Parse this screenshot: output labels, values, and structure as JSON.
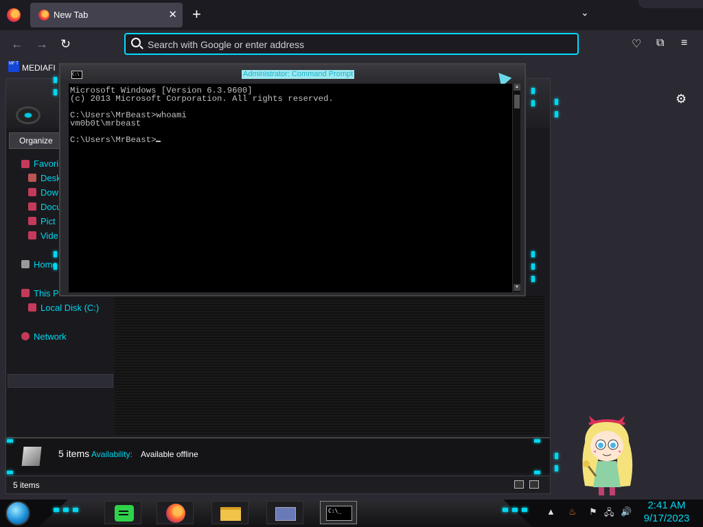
{
  "browser": {
    "tab_title": "New Tab",
    "tab_close": "✕",
    "new_tab": "+",
    "tab_list": "⌄",
    "url_placeholder": "Search with Google or enter address",
    "bookmark_label": "MEDIAFI",
    "bookmark_icon_text": "MF T",
    "nav": {
      "back": "←",
      "forward": "→",
      "reload": "↻"
    },
    "right_icons": {
      "pocket": "♡",
      "extensions": "⧉",
      "menu": "≡"
    },
    "settings_icon": "⚙"
  },
  "explorer": {
    "organize_label": "Organize",
    "tree": [
      {
        "label": "Favori",
        "indent": 0
      },
      {
        "label": "Desk",
        "indent": 1
      },
      {
        "label": "Dow",
        "indent": 1
      },
      {
        "label": "Docu",
        "indent": 1
      },
      {
        "label": "Pict",
        "indent": 1
      },
      {
        "label": "Vide",
        "indent": 1
      },
      {
        "label": "Home",
        "indent": 0
      },
      {
        "label": "This P",
        "indent": 0
      },
      {
        "label": "Local Disk (C:)",
        "indent": 1
      },
      {
        "label": "Network",
        "indent": 0
      }
    ],
    "details": {
      "count": "5 items",
      "availability_label": "Availability:",
      "availability_value": "Available offline"
    },
    "status_count": "5 items"
  },
  "cmd": {
    "title": "Administrator: Command Prompt",
    "icon_text": "C:\\",
    "lines": [
      "Microsoft Windows [Version 6.3.9600]",
      "(c) 2013 Microsoft Corporation. All rights reserved.",
      "",
      "C:\\Users\\MrBeast>whoami",
      "vm0b0t\\mrbeast",
      "",
      "C:\\Users\\MrBeast>"
    ]
  },
  "taskbar": {
    "cmd_text": "C:\\_",
    "tray": {
      "chevron": "▲",
      "flag": "⚑",
      "network": "🖧",
      "volume": "🔊",
      "app": "♨"
    },
    "time": "2:41 AM",
    "date": "9/17/2023"
  },
  "colors": {
    "accent_cyan": "#00d8f0",
    "url_focus": "#00ddff",
    "cmd_text": "#c0c0c0"
  }
}
